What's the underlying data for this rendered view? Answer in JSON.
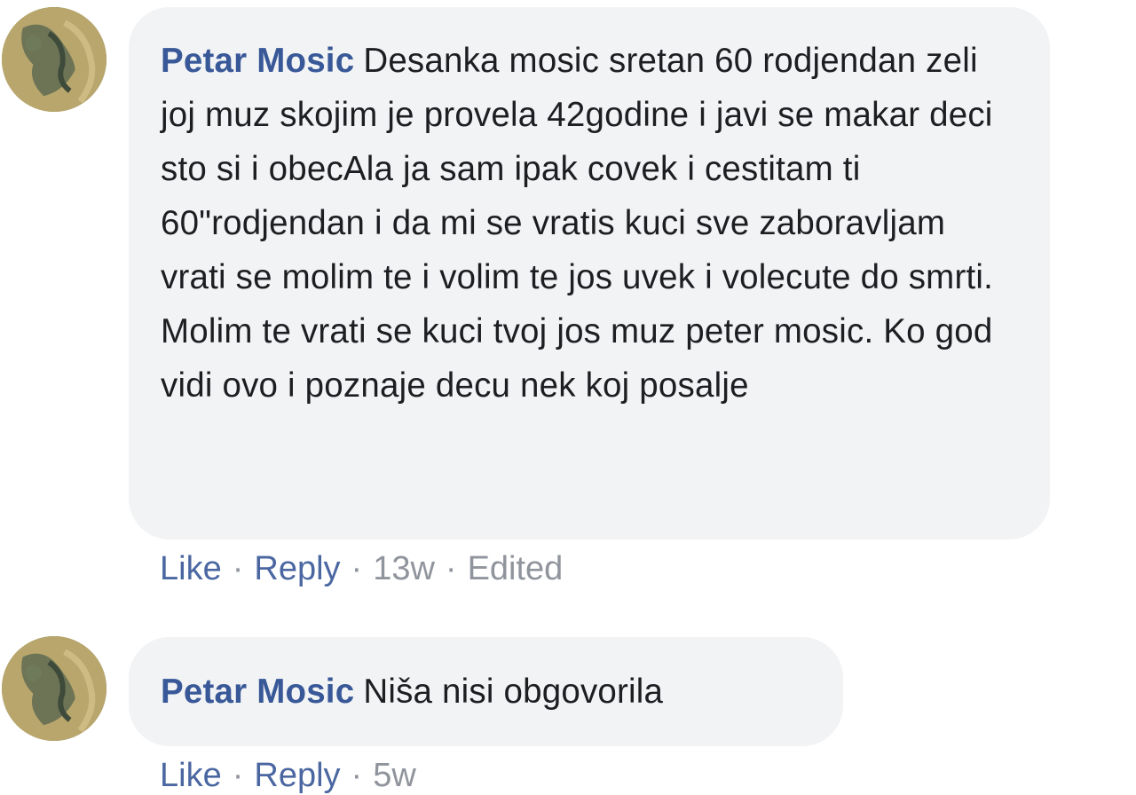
{
  "comments": [
    {
      "author": "Petar Mosic",
      "text": "Desanka mosic sretan 60 rodjendan zeli joj muz skojim je provela 42godine i javi se makar deci sto si i obecAla ja sam ipak covek i cestitam ti 60\"rodjendan i da mi se vratis kuci sve zaboravljam vrati se molim te i volim te jos uvek i volecute do smrti. Molim te vrati se kuci tvoj jos muz peter mosic. Ko god vidi ovo i poznaje decu nek koj posalje",
      "like_label": "Like",
      "reply_label": "Reply",
      "time": "13w",
      "edited": "Edited",
      "separator": "·"
    },
    {
      "author": "Petar Mosic",
      "text": "Niša nisi obgovorila",
      "like_label": "Like",
      "reply_label": "Reply",
      "time": "5w",
      "separator": "·"
    }
  ],
  "icons": {
    "avatar": "profile-photo"
  },
  "colors": {
    "author": "#385898",
    "bubble": "#f2f3f5",
    "action_link": "#4b67a1",
    "meta": "#90949c"
  }
}
